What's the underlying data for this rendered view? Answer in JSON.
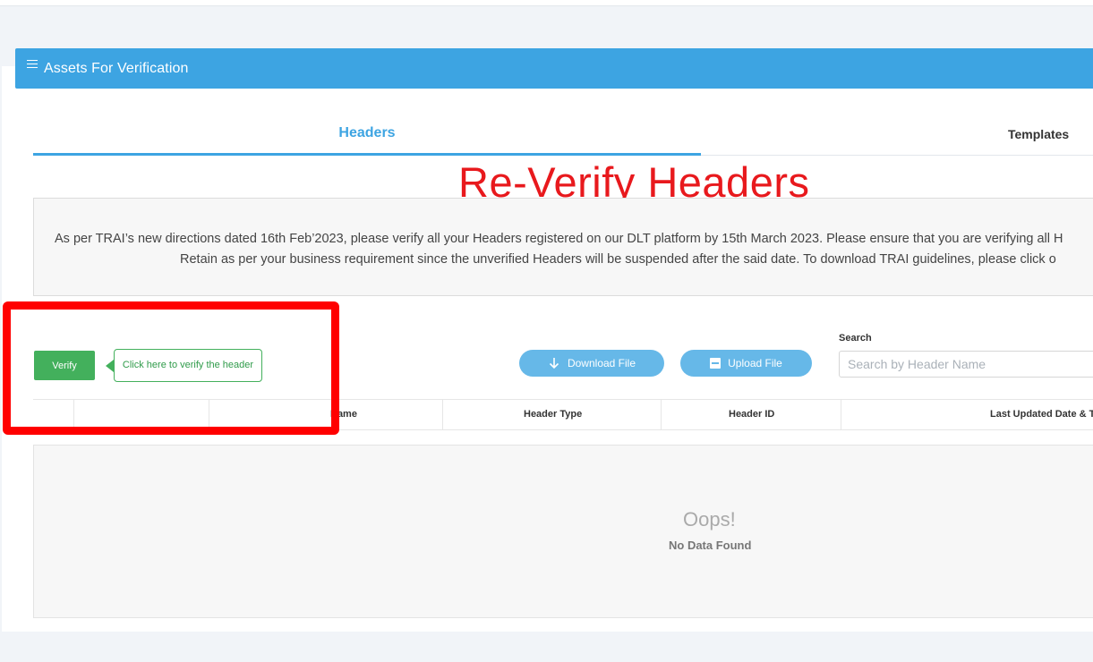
{
  "card": {
    "title": "Assets For Verification"
  },
  "tabs": [
    {
      "label": "Headers",
      "active": true
    },
    {
      "label": "Templates",
      "active": false
    }
  ],
  "annotation": {
    "title": "Re-Verify Headers",
    "color": "#e8191d"
  },
  "notice": {
    "line1": "As per TRAI’s new directions dated 16th Feb’2023, please verify all your Headers registered on our DLT platform by 15th March 2023. Please ensure that you are verifying all H",
    "line2": "Retain as per your business requirement since the unverified Headers will be suspended after the said date. To download TRAI guidelines, please click o"
  },
  "actions": {
    "verify_label": "Verify",
    "verify_hint": "Click here to verify the header",
    "download_label": "Download File",
    "upload_label": "Upload File"
  },
  "search": {
    "label": "Search",
    "placeholder": "Search by Header Name",
    "value": ""
  },
  "table": {
    "columns": [
      "",
      "",
      "Name",
      "Header Type",
      "Header ID",
      "Last Updated Date & Ti"
    ]
  },
  "empty_state": {
    "title": "Oops!",
    "message": "No Data Found"
  },
  "colors": {
    "primary": "#3da4e2",
    "success": "#43b05c",
    "highlight": "#ff0000"
  }
}
